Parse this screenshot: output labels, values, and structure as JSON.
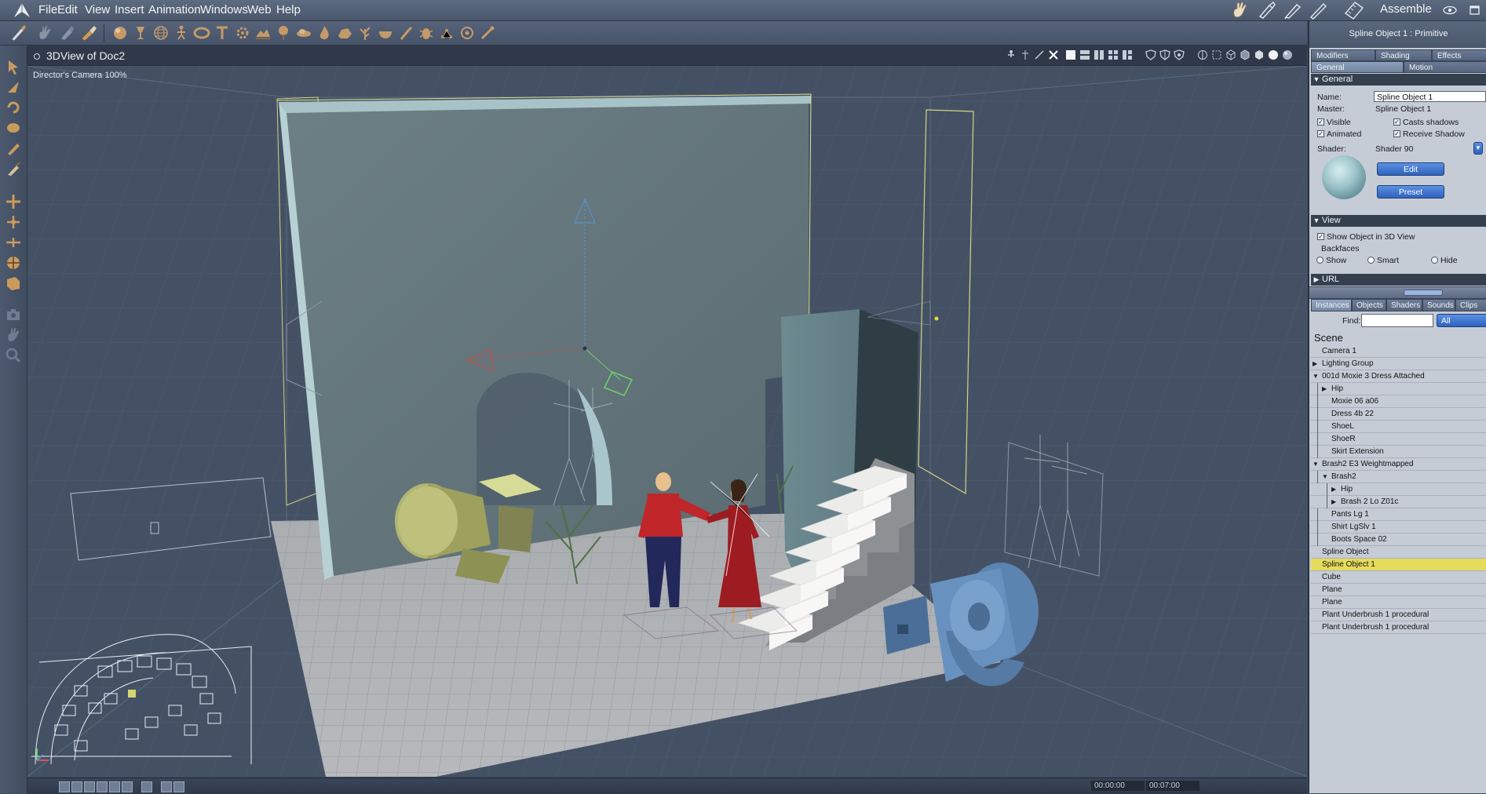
{
  "menu": {
    "items": [
      "File",
      "Edit",
      "View",
      "Insert",
      "Animation",
      "Windows",
      "Web",
      "Help"
    ],
    "mode": "Assemble"
  },
  "viewport": {
    "title": "3DView of Doc2",
    "camera_label": "Director's Camera 100%"
  },
  "properties": {
    "header": "Spline Object 1 : Primitive",
    "tabs_row1": [
      "Modifiers",
      "Shading",
      "Effects"
    ],
    "tabs_row2": [
      "General",
      "Motion"
    ],
    "general_section": "General",
    "name_label": "Name:",
    "name_value": "Spline Object 1",
    "master_label": "Master:",
    "master_value": "Spline Object 1",
    "visible_label": "Visible",
    "casts_shadows_label": "Casts shadows",
    "animated_label": "Animated",
    "receive_shadow_label": "Receive Shadow",
    "shader_label": "Shader:",
    "shader_value": "Shader 90",
    "edit_button": "Edit",
    "preset_button": "Preset",
    "view_section": "View",
    "show_in_3d_label": "Show Object in 3D View",
    "backfaces_label": "Backfaces",
    "backface_options": [
      "Show",
      "Smart",
      "Hide"
    ],
    "url_section": "URL"
  },
  "instances": {
    "tabs": [
      "Instances",
      "Objects",
      "Shaders",
      "Sounds",
      "Clips"
    ],
    "find_label": "Find:",
    "find_value": "",
    "filter_value": "All",
    "scene_title": "Scene",
    "rows": [
      {
        "label": "Camera 1",
        "indent": 0,
        "expander": ""
      },
      {
        "label": "Lighting Group",
        "indent": 0,
        "expander": "closed"
      },
      {
        "label": "001d Moxie 3 Dress Attached",
        "indent": 0,
        "expander": "open"
      },
      {
        "label": "Hip",
        "indent": 1,
        "expander": "closed"
      },
      {
        "label": "Moxie 06 a06",
        "indent": 1,
        "expander": ""
      },
      {
        "label": "Dress 4b 22",
        "indent": 1,
        "expander": ""
      },
      {
        "label": "ShoeL",
        "indent": 1,
        "expander": ""
      },
      {
        "label": "ShoeR",
        "indent": 1,
        "expander": ""
      },
      {
        "label": "Skirt Extension",
        "indent": 1,
        "expander": ""
      },
      {
        "label": "Brash2 E3 Weightmapped",
        "indent": 0,
        "expander": "open"
      },
      {
        "label": "Brash2",
        "indent": 1,
        "expander": "open"
      },
      {
        "label": "Hip",
        "indent": 2,
        "expander": "closed"
      },
      {
        "label": "Brash 2 Lo Z01c",
        "indent": 2,
        "expander": "closed"
      },
      {
        "label": "Pants Lg 1",
        "indent": 1,
        "expander": ""
      },
      {
        "label": "Shirt LgSlv 1",
        "indent": 1,
        "expander": ""
      },
      {
        "label": "Boots Space 02",
        "indent": 1,
        "expander": ""
      },
      {
        "label": "Spline Object",
        "indent": 0,
        "expander": ""
      },
      {
        "label": "Spline Object 1",
        "indent": 0,
        "expander": "",
        "selected": true
      },
      {
        "label": "Cube",
        "indent": 0,
        "expander": ""
      },
      {
        "label": "Plane",
        "indent": 0,
        "expander": ""
      },
      {
        "label": "Plane",
        "indent": 0,
        "expander": ""
      },
      {
        "label": "Plant Underbrush 1 procedural",
        "indent": 0,
        "expander": ""
      },
      {
        "label": "Plant Underbrush 1 procedural",
        "indent": 0,
        "expander": ""
      }
    ]
  },
  "timeline": {
    "current_time": "00:00:00",
    "end_time": "00:07:00"
  },
  "colors": {
    "selection_highlight": "#e6db5c",
    "panel_bg": "#c6ccd6",
    "viewport_bg": "#445165",
    "accent_button": "#3c70c8"
  },
  "icons": {
    "toolbar": [
      "brush-icon",
      "hand-icon",
      "grab-icon",
      "paint-icon",
      "sphere-icon",
      "goblet-icon",
      "globe-icon",
      "figure-icon",
      "torus-icon",
      "text-icon",
      "gear-icon",
      "terrain-icon",
      "tree-icon",
      "cloud-icon",
      "flame-icon",
      "rock-icon",
      "plant-icon",
      "bowl-icon",
      "torch-icon",
      "bug-icon",
      "particles-icon",
      "target-icon",
      "bone-icon"
    ],
    "left_tools": [
      "select-arrow-icon",
      "select-object-icon",
      "rotate-icon",
      "twist-icon",
      "pencil-icon",
      "brush-icon",
      "move-icon",
      "move-plane-icon",
      "move-axis-icon",
      "rotate-sphere-icon",
      "scale-icon",
      "camera-icon",
      "pan-hand-icon",
      "zoom-icon"
    ]
  }
}
